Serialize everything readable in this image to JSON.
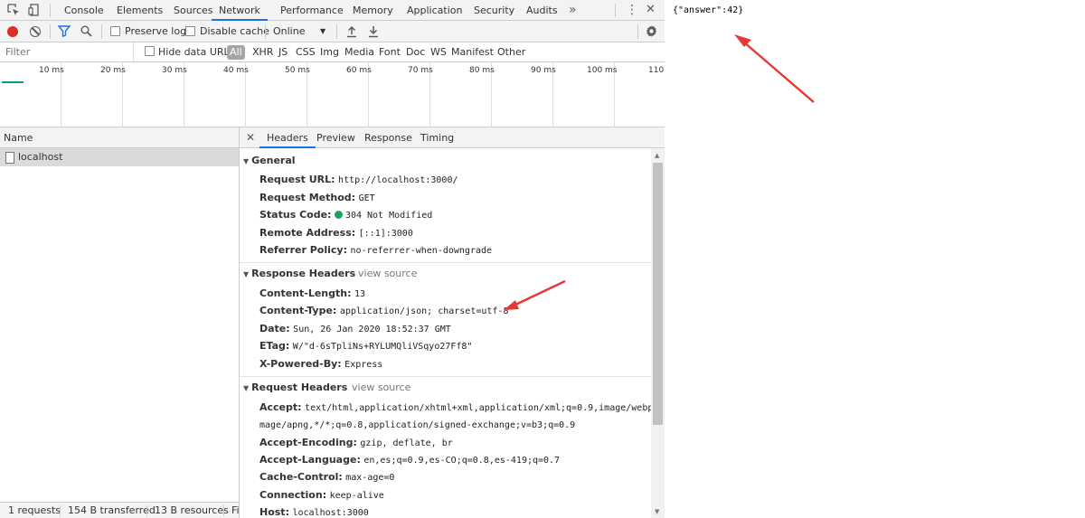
{
  "devtools": {
    "tabs": [
      "Console",
      "Elements",
      "Sources",
      "Network",
      "Performance",
      "Memory",
      "Application",
      "Security",
      "Audits"
    ],
    "active_tab": "Network",
    "more_tabs": "»",
    "kebab": "⋮",
    "close": "✕",
    "toolbar": {
      "preserve_log": "Preserve log",
      "disable_cache": "Disable cache",
      "throttling": "Online",
      "throttling_arrow": "▼"
    },
    "filter": {
      "placeholder": "Filter",
      "hide_data_urls": "Hide data URLs",
      "types": [
        "All",
        "XHR",
        "JS",
        "CSS",
        "Img",
        "Media",
        "Font",
        "Doc",
        "WS",
        "Manifest",
        "Other"
      ],
      "active_type": "All"
    },
    "timeline": {
      "ticks": [
        "10 ms",
        "20 ms",
        "30 ms",
        "40 ms",
        "50 ms",
        "60 ms",
        "70 ms",
        "80 ms",
        "90 ms",
        "100 ms",
        "110"
      ]
    },
    "requests": {
      "column": "Name",
      "items": [
        {
          "name": "localhost"
        }
      ]
    },
    "status_bar": {
      "requests": "1 requests",
      "transferred": "154 B transferred",
      "resources": "13 B resources",
      "more": "Fi"
    },
    "detail_tabs": [
      "Headers",
      "Preview",
      "Response",
      "Timing"
    ],
    "detail_active_tab": "Headers",
    "detail_close": "✕",
    "general": {
      "title": "General",
      "rows": [
        {
          "key": "Request URL:",
          "value": "http://localhost:3000/"
        },
        {
          "key": "Request Method:",
          "value": "GET"
        },
        {
          "key": "Status Code:",
          "value": "304 Not Modified",
          "status_color": "#1aa260"
        },
        {
          "key": "Remote Address:",
          "value": "[::1]:3000"
        },
        {
          "key": "Referrer Policy:",
          "value": "no-referrer-when-downgrade"
        }
      ]
    },
    "response_headers": {
      "title": "Response Headers",
      "view_source": "view source",
      "rows": [
        {
          "key": "Content-Length:",
          "value": "13"
        },
        {
          "key": "Content-Type:",
          "value": "application/json; charset=utf-8"
        },
        {
          "key": "Date:",
          "value": "Sun, 26 Jan 2020 18:52:37 GMT"
        },
        {
          "key": "ETag:",
          "value": "W/\"d-6sTpliNs+RYLUMQliVSqyo27Ff8\""
        },
        {
          "key": "X-Powered-By:",
          "value": "Express"
        }
      ]
    },
    "request_headers": {
      "title": "Request Headers",
      "view_source": "view source",
      "rows": [
        {
          "key": "Accept:",
          "value": "text/html,application/xhtml+xml,application/xml;q=0.9,image/webp,i",
          "cont": "mage/apng,*/*;q=0.8,application/signed-exchange;v=b3;q=0.9"
        },
        {
          "key": "Accept-Encoding:",
          "value": "gzip, deflate, br"
        },
        {
          "key": "Accept-Language:",
          "value": "en,es;q=0.9,es-CO;q=0.8,es-419;q=0.7"
        },
        {
          "key": "Cache-Control:",
          "value": "max-age=0"
        },
        {
          "key": "Connection:",
          "value": "keep-alive"
        },
        {
          "key": "Host:",
          "value": "localhost:3000"
        }
      ]
    }
  },
  "page": {
    "body_text": "{\"answer\":42}",
    "annotation_color": "#e53935"
  }
}
